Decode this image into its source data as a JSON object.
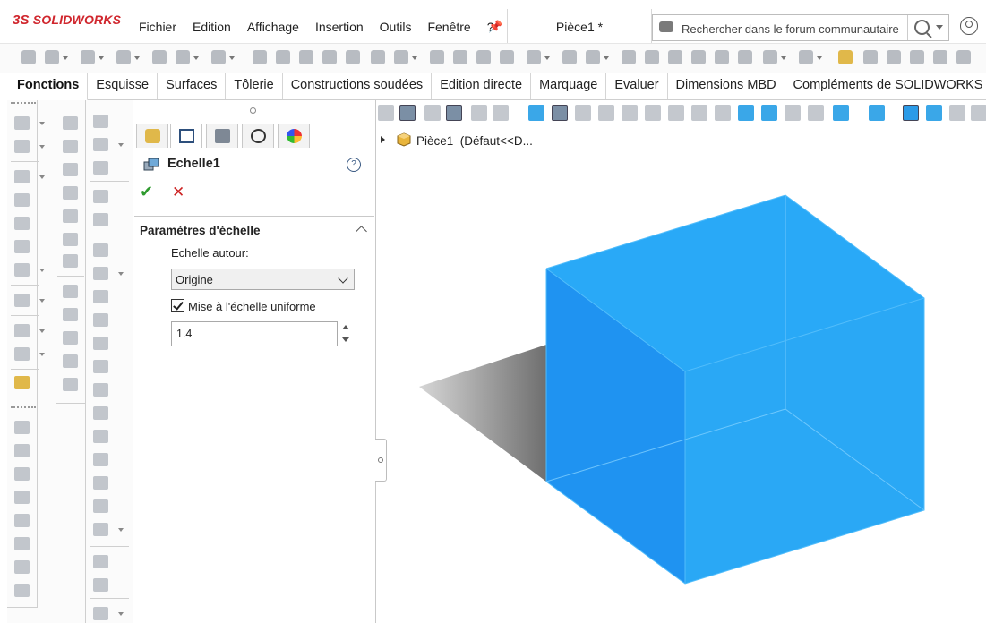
{
  "app": {
    "logo_text": "SOLIDWORKS",
    "logo_prefix": "3S",
    "document_title": "Pièce1 *"
  },
  "menu": [
    "Fichier",
    "Edition",
    "Affichage",
    "Insertion",
    "Outils",
    "Fenêtre",
    "?"
  ],
  "search": {
    "placeholder": "Rechercher dans le forum communautaire"
  },
  "command_tabs": [
    "Fonctions",
    "Esquisse",
    "Surfaces",
    "Tôlerie",
    "Constructions soudées",
    "Edition directe",
    "Marquage",
    "Evaluer",
    "Dimensions MBD",
    "Compléments de SOLIDWORKS"
  ],
  "property_manager": {
    "title": "Echelle1",
    "help_symbol": "?",
    "group_title": "Paramètres d'échelle",
    "scale_about_label": "Echelle autour:",
    "scale_about_value": "Origine",
    "uniform_label": "Mise à l'échelle uniforme",
    "uniform_checked": true,
    "scale_factor": "1.4"
  },
  "feature_tree": {
    "part_label": "Pièce1  (Défaut<<D..."
  },
  "colors": {
    "accent_red": "#d0262d",
    "cube_front": "#1e90f0",
    "cube_top": "#27a8f8",
    "cube_right": "#2aaaf6",
    "ok_green": "#2f9b2f",
    "cancel_red": "#cc2222"
  },
  "icons": {
    "ok": "check-icon",
    "cancel": "close-icon",
    "help": "help-icon",
    "search": "search-icon",
    "user": "user-icon"
  }
}
